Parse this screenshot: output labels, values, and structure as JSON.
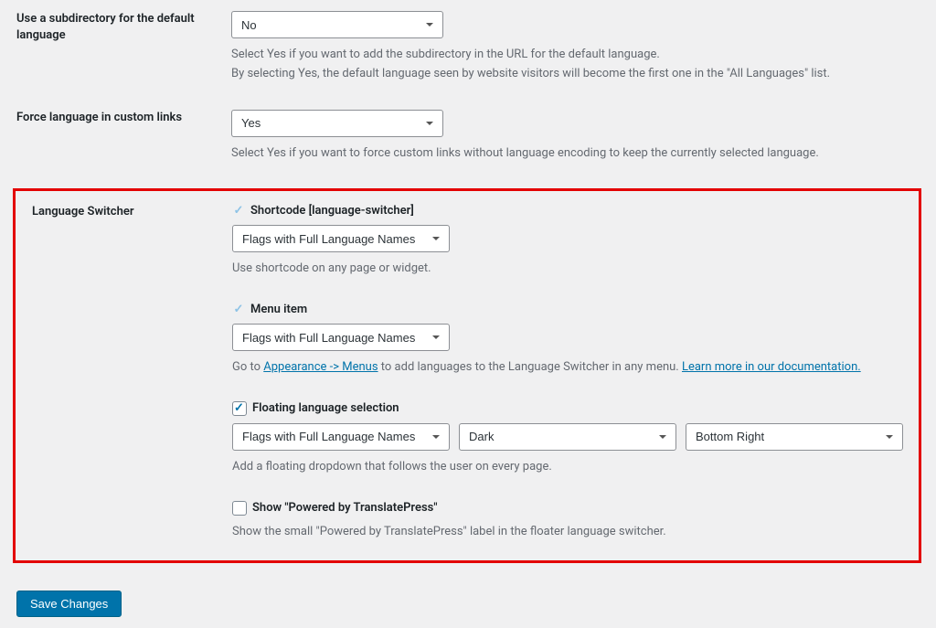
{
  "subdir": {
    "label": "Use a subdirectory for the default language",
    "value": "No",
    "desc1": "Select Yes if you want to add the subdirectory in the URL for the default language.",
    "desc2": "By selecting Yes, the default language seen by website visitors will become the first one in the \"All Languages\" list."
  },
  "force": {
    "label": "Force language in custom links",
    "value": "Yes",
    "desc": "Select Yes if you want to force custom links without language encoding to keep the currently selected language."
  },
  "switcher": {
    "label": "Language Switcher",
    "shortcode": {
      "label": "Shortcode [language-switcher]",
      "sel": "Flags with Full Language Names",
      "desc": "Use shortcode on any page or widget."
    },
    "menu": {
      "label": "Menu item",
      "sel": "Flags with Full Language Names",
      "desc_pre": "Go to ",
      "link1": "Appearance -> Menus",
      "desc_mid": " to add languages to the Language Switcher in any menu. ",
      "link2": "Learn more in our documentation."
    },
    "floating": {
      "label": "Floating language selection",
      "sel1": "Flags with Full Language Names",
      "sel2": "Dark",
      "sel3": "Bottom Right",
      "desc": "Add a floating dropdown that follows the user on every page."
    },
    "powered": {
      "label": "Show \"Powered by TranslatePress\"",
      "desc": "Show the small \"Powered by TranslatePress\" label in the floater language switcher."
    }
  },
  "save": "Save Changes"
}
